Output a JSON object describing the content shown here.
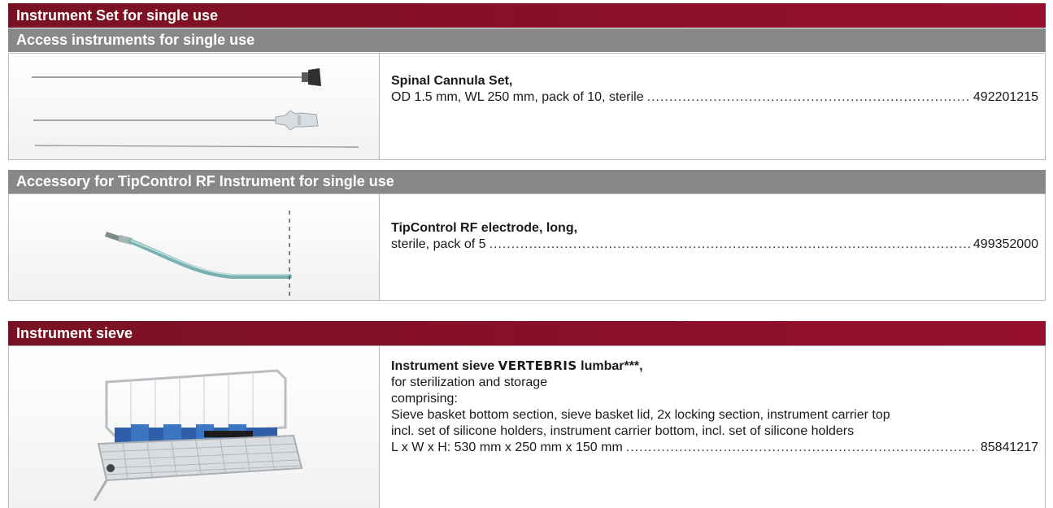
{
  "sections": {
    "set": {
      "title": "Instrument Set for single use"
    },
    "access": {
      "title": "Access instruments for single use"
    },
    "accessory": {
      "title": "Accessory for TipControl RF Instrument for single use"
    },
    "sieve": {
      "title": "Instrument sieve"
    }
  },
  "products": {
    "cannula": {
      "name": "Spinal Cannula Set,",
      "spec": "OD 1.5 mm, WL 250 mm, pack of 10, sterile",
      "number": "492201215",
      "image_icon": "cannula-image"
    },
    "electrode": {
      "name": "TipControl RF electrode, long,",
      "spec": "sterile, pack of 5",
      "number": "499352000",
      "image_icon": "electrode-image"
    },
    "sieve": {
      "name_prefix": "Instrument sieve ",
      "brand": "VERTEBRIS",
      "name_suffix": " lumbar***,",
      "lines": [
        "for sterilization and storage",
        "comprising:",
        "Sieve basket bottom section, sieve basket lid, 2x locking section, instrument carrier top",
        "incl. set of silicone holders, instrument carrier bottom, incl. set of silicone holders"
      ],
      "dims": "L x W x H: 530 mm x 250 mm x 150 mm",
      "number": "85841217",
      "image_icon": "sieve-basket-image"
    }
  },
  "colors": {
    "header_red": "#8a0f28",
    "header_gray": "#888888",
    "border": "#b9b9b9"
  }
}
